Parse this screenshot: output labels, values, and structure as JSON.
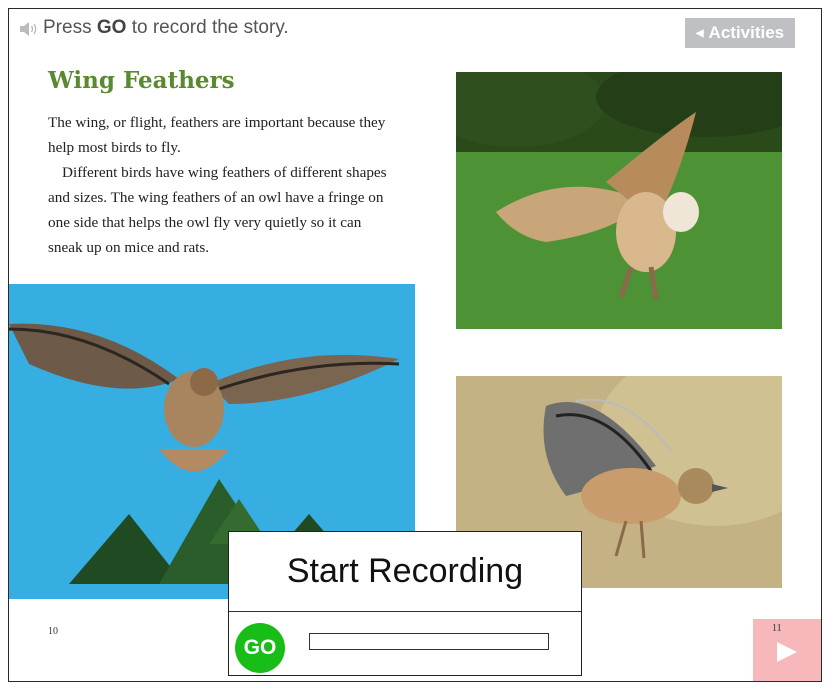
{
  "header": {
    "speaker_icon": "speaker-icon",
    "instruction_pre": "Press ",
    "instruction_go": "GO",
    "instruction_post": " to record the story.",
    "activities_label": "Activities"
  },
  "page": {
    "title": "Wing Feathers",
    "paragraph_1": "The wing, or flight, feathers are important because they help most birds to fly.",
    "paragraph_2": "Different birds have wing feathers of different shapes and sizes. The wing feathers of an owl have a fringe on one side that helps the owl fly very quietly so it can sneak up on mice and rats.",
    "page_left": "10",
    "page_right": "11"
  },
  "recorder": {
    "title": "Start Recording",
    "go_label": "GO",
    "progress": 0
  },
  "colors": {
    "title_green": "#5a8a2f",
    "go_green": "#19bd17",
    "next_pink": "#f6b8bb",
    "activities_gray": "#bfc0c3"
  }
}
